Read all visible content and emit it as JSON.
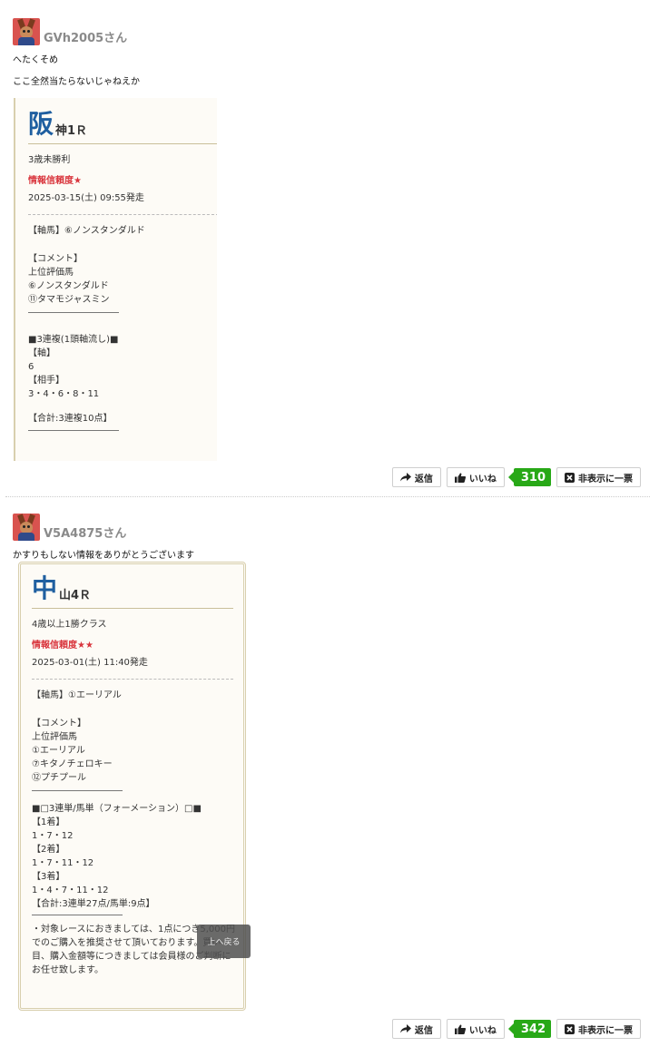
{
  "posts": [
    {
      "username": "GVh2005さん",
      "comment": "へたくそめ\n\nここ全然当たらないじゃねえか",
      "card": {
        "big_char": "阪",
        "track": "神1Ｒ",
        "race_class": "3歳未勝利",
        "reliability": "情報信頼度★",
        "start": "2025-03-15(土) 09:55発走",
        "axis": "【軸馬】⑥ノンスタンダルド",
        "comment_lines": [
          "【コメント】",
          "上位評価馬",
          "⑥ノンスタンダルド",
          "⑪タマモジャスミン"
        ],
        "bet_lines": [
          "■3連複(1頭軸流し)■",
          "【軸】",
          "6",
          "【相手】",
          "3・4・6・8・11"
        ],
        "total": "【合計:3連複10点】"
      },
      "actions": {
        "reply": "返信",
        "like": "いいね",
        "count": "310",
        "hide": "非表示に一票"
      }
    },
    {
      "username": "V5A4875さん",
      "comment": "かすりもしない情報をありがとうございます",
      "card": {
        "big_char": "中",
        "track": "山4Ｒ",
        "race_class": "4歳以上1勝クラス",
        "reliability": "情報信頼度★★",
        "start": "2025-03-01(土) 11:40発走",
        "axis": "【軸馬】①エーリアル",
        "comment_lines": [
          "【コメント】",
          "上位評価馬",
          "①エーリアル",
          "⑦キタノチェロキー",
          "⑫プチプール"
        ],
        "bet_lines": [
          "■□3連単/馬単（フォーメーション）□■",
          "【1着】",
          "1・7・12",
          "【2着】",
          "1・7・11・12",
          "【3着】",
          "1・4・7・11・12",
          "【合計:3連単27点/馬単:9点】"
        ],
        "note_lines": [
          "・対象レースにおきましては、1点につき5,000円",
          "でのご購入を推奨させて頂いております。買い",
          "目、購入金額等につきましては会員様のご判断に",
          "お任せ致します。"
        ]
      },
      "actions": {
        "reply": "返信",
        "like": "いいね",
        "count": "342",
        "hide": "非表示に一票"
      }
    }
  ],
  "to_top": "上へ戻る"
}
